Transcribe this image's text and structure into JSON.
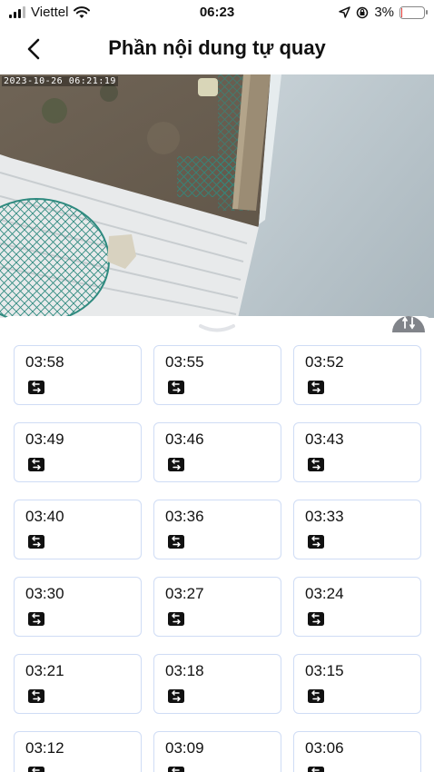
{
  "status_bar": {
    "carrier": "Viettel",
    "time": "06:23",
    "battery": "3%",
    "battery_level_percent": 3
  },
  "header": {
    "title": "Phần nội dung tự quay"
  },
  "video": {
    "timestamp": "2023-10-26 06:21:19"
  },
  "recordings": [
    {
      "time": "03:58"
    },
    {
      "time": "03:55"
    },
    {
      "time": "03:52"
    },
    {
      "time": "03:49"
    },
    {
      "time": "03:46"
    },
    {
      "time": "03:43"
    },
    {
      "time": "03:40"
    },
    {
      "time": "03:36"
    },
    {
      "time": "03:33"
    },
    {
      "time": "03:30"
    },
    {
      "time": "03:27"
    },
    {
      "time": "03:24"
    },
    {
      "time": "03:21"
    },
    {
      "time": "03:18"
    },
    {
      "time": "03:15"
    },
    {
      "time": "03:12"
    },
    {
      "time": "03:09"
    },
    {
      "time": "03:06"
    }
  ],
  "icons": {
    "back": "chevron-left-icon",
    "recording": "swap-arrows-icon",
    "pip": "picture-in-picture-icon",
    "handle": "chevron-down-icon"
  },
  "colors": {
    "card_border": "#cfdcf5",
    "battery_low": "#e53935",
    "icon_dark": "#111111"
  }
}
